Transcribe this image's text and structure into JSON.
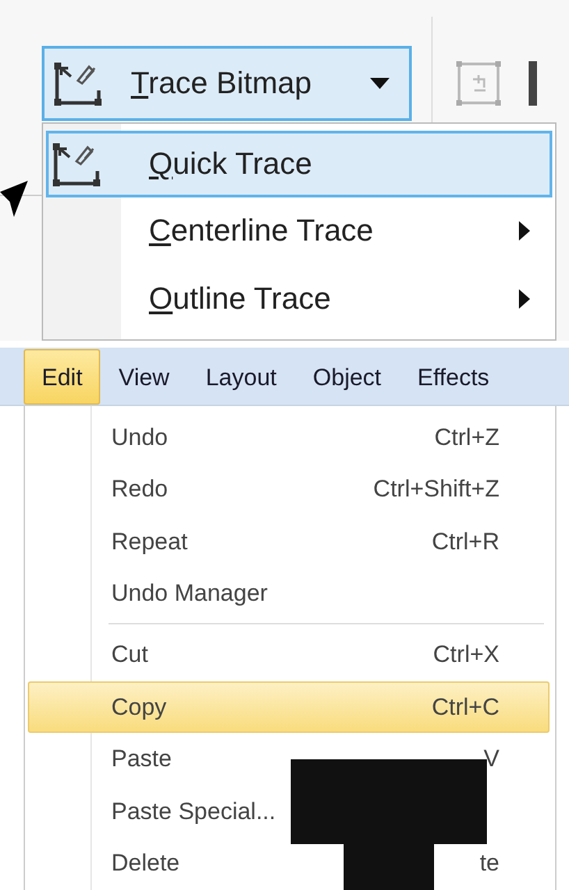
{
  "toolbar": {
    "trace_button": {
      "mnemonic": "T",
      "rest": "race Bitmap",
      "active": true
    }
  },
  "trace_menu": [
    {
      "kind": "icon_item",
      "mnemonic": "Q",
      "rest": "uick Trace",
      "selected": true
    },
    {
      "kind": "submenu_item",
      "mnemonic": "C",
      "rest": "enterline Trace",
      "selected": false
    },
    {
      "kind": "submenu_item",
      "mnemonic": "O",
      "rest": "utline Trace",
      "selected": false
    }
  ],
  "menu_bar": [
    {
      "label": "Edit",
      "selected": true
    },
    {
      "label": "View",
      "selected": false
    },
    {
      "label": "Layout",
      "selected": false
    },
    {
      "label": "Object",
      "selected": false
    },
    {
      "label": "Effects",
      "selected": false
    }
  ],
  "edit_menu": [
    {
      "kind": "item",
      "label": "Undo",
      "shortcut": "Ctrl+Z",
      "selected": false
    },
    {
      "kind": "item",
      "label": "Redo",
      "shortcut": "Ctrl+Shift+Z",
      "selected": false
    },
    {
      "kind": "item",
      "label": "Repeat",
      "shortcut": "Ctrl+R",
      "selected": false
    },
    {
      "kind": "item",
      "label": "Undo Manager",
      "selected": false
    },
    {
      "kind": "separator"
    },
    {
      "kind": "item",
      "label": "Cut",
      "shortcut": "Ctrl+X",
      "selected": false
    },
    {
      "kind": "item",
      "label": "Copy",
      "shortcut": "Ctrl+C",
      "selected": true
    },
    {
      "kind": "item",
      "label": "Paste",
      "shortcut": "V",
      "selected": false
    },
    {
      "kind": "item",
      "label": "Paste Special...",
      "selected": false
    },
    {
      "kind": "item",
      "label": "Delete",
      "shortcut": "te",
      "selected": false
    }
  ]
}
